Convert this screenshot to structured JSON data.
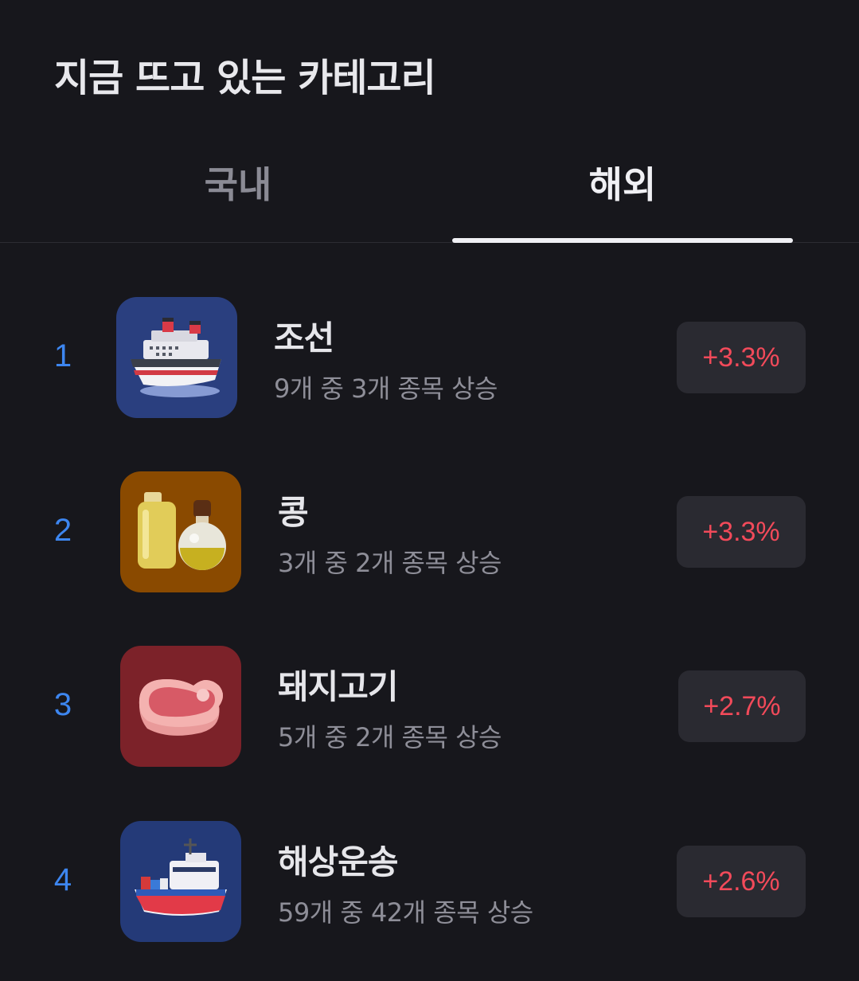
{
  "header": {
    "title": "지금 뜨고 있는 카테고리"
  },
  "tabs": [
    {
      "label": "국내",
      "selected": false
    },
    {
      "label": "해외",
      "selected": true
    }
  ],
  "categories": [
    {
      "rank": "1",
      "name": "조선",
      "subtitle": "9개 중 3개 종목 상승",
      "change": "+3.3%",
      "icon": "cruise-ship-icon",
      "icon_bg": "#2a3f7f"
    },
    {
      "rank": "2",
      "name": "콩",
      "subtitle": "3개 중 2개 종목 상승",
      "change": "+3.3%",
      "icon": "oil-bottles-icon",
      "icon_bg": "#8a4a00"
    },
    {
      "rank": "3",
      "name": "돼지고기",
      "subtitle": "5개 중 2개 종목 상승",
      "change": "+2.7%",
      "icon": "meat-steak-icon",
      "icon_bg": "#7c2229"
    },
    {
      "rank": "4",
      "name": "해상운송",
      "subtitle": "59개 중 42개 종목 상승",
      "change": "+2.6%",
      "icon": "cargo-ship-icon",
      "icon_bg": "#243a78"
    }
  ],
  "colors": {
    "background": "#17171c",
    "rank": "#3d86f0",
    "change_positive": "#f24a5a",
    "badge_bg": "#2a2a31"
  }
}
